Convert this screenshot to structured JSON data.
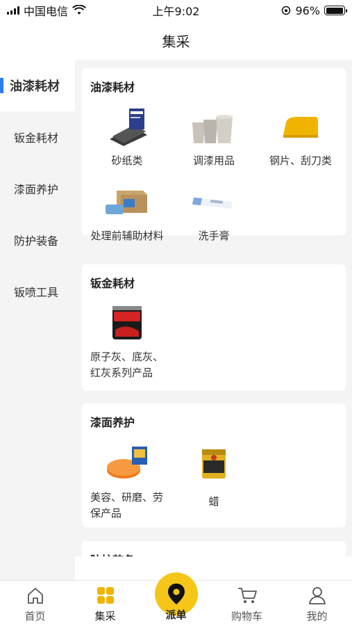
{
  "status_bar": {
    "carrier": "中国电信",
    "time": "上午9:02",
    "battery": "96%",
    "battery_level": 0.96
  },
  "nav": {
    "title": "集采"
  },
  "sidebar": {
    "items": [
      {
        "label": "油漆耗材",
        "active": true
      },
      {
        "label": "钣金耗材",
        "active": false
      },
      {
        "label": "漆面养护",
        "active": false
      },
      {
        "label": "防护装备",
        "active": false
      },
      {
        "label": "钣喷工具",
        "active": false
      }
    ]
  },
  "sections": [
    {
      "title": "油漆耗材",
      "items": [
        {
          "label": "砂纸类",
          "icon": "sandpaper-icon"
        },
        {
          "label": "调漆用品",
          "icon": "mixing-cups-icon"
        },
        {
          "label": "钢片、刮刀类",
          "icon": "scraper-icon"
        },
        {
          "label": "处理前辅助材料",
          "icon": "pretreatment-box-icon"
        },
        {
          "label": "洗手膏",
          "icon": "hand-cleaner-icon"
        }
      ]
    },
    {
      "title": "钣金耗材",
      "items": [
        {
          "label": "原子灰、底灰、红灰系列产品",
          "line1": "原子灰、底灰、",
          "line2": "红灰系列产品",
          "icon": "putty-can-icon"
        }
      ]
    },
    {
      "title": "漆面养护",
      "items": [
        {
          "label": "美容、研磨、劳保产品",
          "line1": "美容、研磨、劳",
          "line2": "保产品",
          "icon": "polishing-pad-icon"
        },
        {
          "label": "蜡",
          "icon": "wax-tin-icon"
        }
      ]
    },
    {
      "title": "防护装备"
    }
  ],
  "tab_bar": {
    "tabs": [
      {
        "label": "首页",
        "icon": "home-icon"
      },
      {
        "label": "集采",
        "icon": "grid-icon",
        "active": true
      },
      {
        "label": "派单",
        "icon": "location-pin-icon"
      },
      {
        "label": "购物车",
        "icon": "cart-icon"
      },
      {
        "label": "我的",
        "icon": "user-icon"
      }
    ]
  },
  "colors": {
    "accent_yellow": "#f5c518",
    "active_indicator": "#2a7ef2",
    "panel_bg": "#f4f4f4"
  }
}
